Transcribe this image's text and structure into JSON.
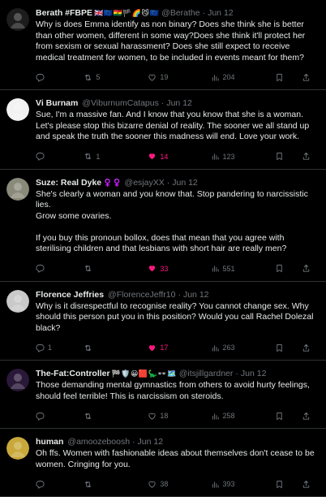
{
  "colors": {
    "background": "#000000",
    "text": "#e7e9ea",
    "muted": "#71767b",
    "divider": "#2f3336",
    "like_active": "#f91880"
  },
  "tweets": [
    {
      "name": "Berath #FBPE",
      "emojis": "🇬🇧🇪🇺🇬🇭🏴🌈😼🇪🇺",
      "handle": "@Berathe",
      "date": "Jun 12",
      "text": "Why is does Emma identify as non binary? Does she think she is better than other women, different in some way?Does she think it'll protect her from sexism or sexual harassment? Does she still expect to receive medical treatment for women, to be included in events meant for them?",
      "replies": "",
      "retweets": "5",
      "likes": "19",
      "liked": false,
      "views": "204",
      "avatar_color": "#1d1d1d"
    },
    {
      "name": "Vi Burnam",
      "emojis": "",
      "handle": "@ViburnumCatapus",
      "date": "Jun 12",
      "text": "Sue, I'm a massive fan. And I know that you know that she is a woman. Let's please stop this bizarre denial of reality. The sooner we all stand up and speak the truth the sooner this madness will end. Love your work.",
      "replies": "",
      "retweets": "1",
      "likes": "14",
      "liked": true,
      "views": "123",
      "avatar_color": "#f2f2f2"
    },
    {
      "name": "Suze: Real Dyke",
      "emojis": "♀️♀️",
      "handle": "@esjayXX",
      "date": "Jun 12",
      "text": "She's clearly a woman and you know that. Stop pandering to narcissistic lies.\nGrow some ovaries.\n\nIf you buy this pronoun bollox, does that mean that you agree with sterilising children and that lesbians with short hair are really men?",
      "replies": "",
      "retweets": "",
      "likes": "33",
      "liked": true,
      "views": "551",
      "avatar_color": "#8a8a7a"
    },
    {
      "name": "Florence Jeffries",
      "emojis": "",
      "handle": "@FlorenceJeffr10",
      "date": "Jun 12",
      "text": "Why is it disrespectful to recognise reality? You cannot change sex. Why should this person put you in this position? Would you call Rachel Dolezal black?",
      "replies": "1",
      "retweets": "",
      "likes": "17",
      "liked": true,
      "views": "263",
      "avatar_color": "#c9c9c9"
    },
    {
      "name": "The-Fat:Controller",
      "emojis": "🏁🛡️😀🟥🦕👓🗺️",
      "handle": "@itsjillgardner",
      "date": "Jun 12",
      "text": "Those demanding mental gymnastics from others to avoid hurty feelings, should feel terrible! This is narcissism on steroids.",
      "replies": "",
      "retweets": "",
      "likes": "18",
      "liked": false,
      "views": "258",
      "avatar_color": "#2a1838"
    },
    {
      "name": "human",
      "emojis": "",
      "handle": "@amoozeboosh",
      "date": "Jun 12",
      "text": "Oh ffs. Women with fashionable ideas about themselves don't cease to be women. Cringing for you.",
      "replies": "",
      "retweets": "",
      "likes": "38",
      "liked": false,
      "views": "393",
      "avatar_color": "#c8a83a"
    }
  ]
}
